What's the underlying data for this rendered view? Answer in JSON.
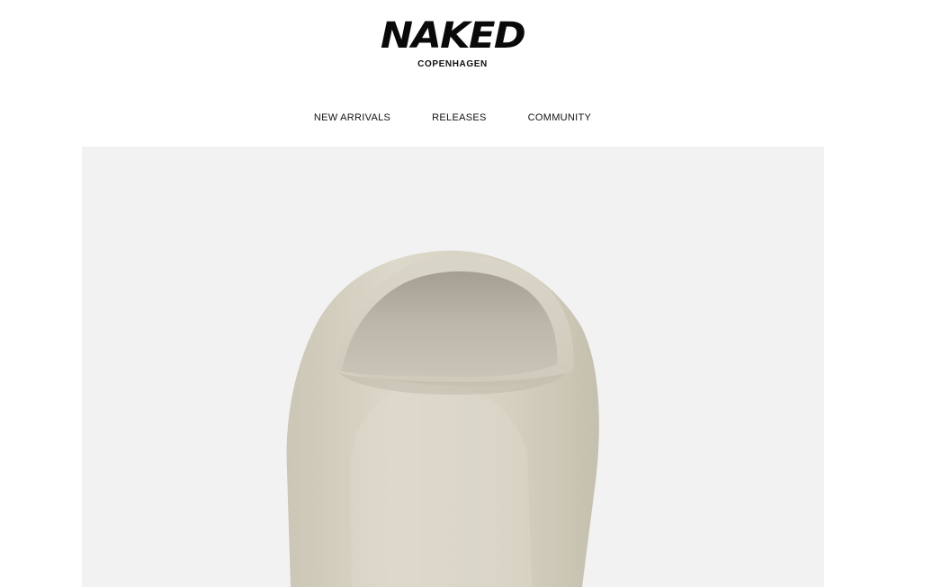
{
  "brand": {
    "name": "NAKED",
    "tagline": "COPENHAGEN"
  },
  "nav": {
    "items": [
      {
        "label": "NEW ARRIVALS"
      },
      {
        "label": "RELEASES"
      },
      {
        "label": "COMMUNITY"
      }
    ]
  },
  "hero": {
    "image": "beige-foam-slide-product-photo",
    "background_color": "#f2f2f2",
    "product_color": "#d8d4c6"
  }
}
